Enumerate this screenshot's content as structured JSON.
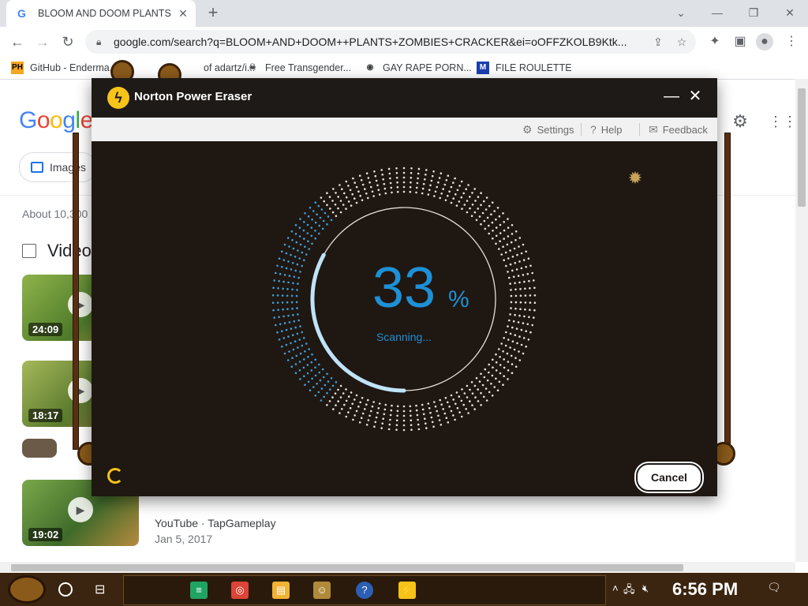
{
  "browser": {
    "tab_title": "BLOOM AND DOOM PLANTS",
    "tab_favicon": "G",
    "url": "google.com/search?q=BLOOM+AND+DOOM++PLANTS+ZOMBIES+CRACKER&ei=oOFFZKOLB9Ktk...",
    "bookmarks": [
      {
        "label": "GitHub - Enderma...",
        "icon": "PH",
        "color": "#f5a623"
      },
      {
        "label": "of adartz/i...",
        "icon": "",
        "color": "#555555"
      },
      {
        "label": "Free Transgender...",
        "icon": "☠",
        "color": "#333333"
      },
      {
        "label": "GAY RAPE PORN...",
        "icon": "◉",
        "color": "#333333"
      },
      {
        "label": "FILE ROULETTE",
        "icon": "M",
        "color": "#1a3fb0"
      }
    ]
  },
  "google": {
    "logo": "Google",
    "images_chip": "Images",
    "about": "About 10,300",
    "videos_heading": "Video",
    "videos": [
      {
        "duration": "24:09",
        "color": "#4d7a2a"
      },
      {
        "duration": "18:17",
        "color": "#5a7a2e"
      },
      {
        "duration": "19:02",
        "color": "#3f6b2a",
        "source": "YouTube · TapGameplay",
        "date": "Jan 5, 2017"
      }
    ]
  },
  "norton": {
    "title": "Norton Power Eraser",
    "menu": {
      "settings": "Settings",
      "help": "Help",
      "feedback": "Feedback"
    },
    "progress_percent": 33,
    "percent_number": "33",
    "percent_sign": "%",
    "status": "Scanning...",
    "cancel": "Cancel",
    "accent": "#1e90d6",
    "brand_yellow": "#f6c319"
  },
  "taskbar": {
    "clock": "6:56 PM",
    "apps": [
      {
        "icon": "≡",
        "color": "#1fa463"
      },
      {
        "icon": "◎",
        "color": "#db4437"
      },
      {
        "icon": "▤",
        "color": "#f2b233"
      },
      {
        "icon": "☺",
        "color": "#b08a3a"
      },
      {
        "icon": "?",
        "color": "#2b5fb4"
      },
      {
        "icon": "⚡",
        "color": "#f6c319"
      }
    ]
  }
}
